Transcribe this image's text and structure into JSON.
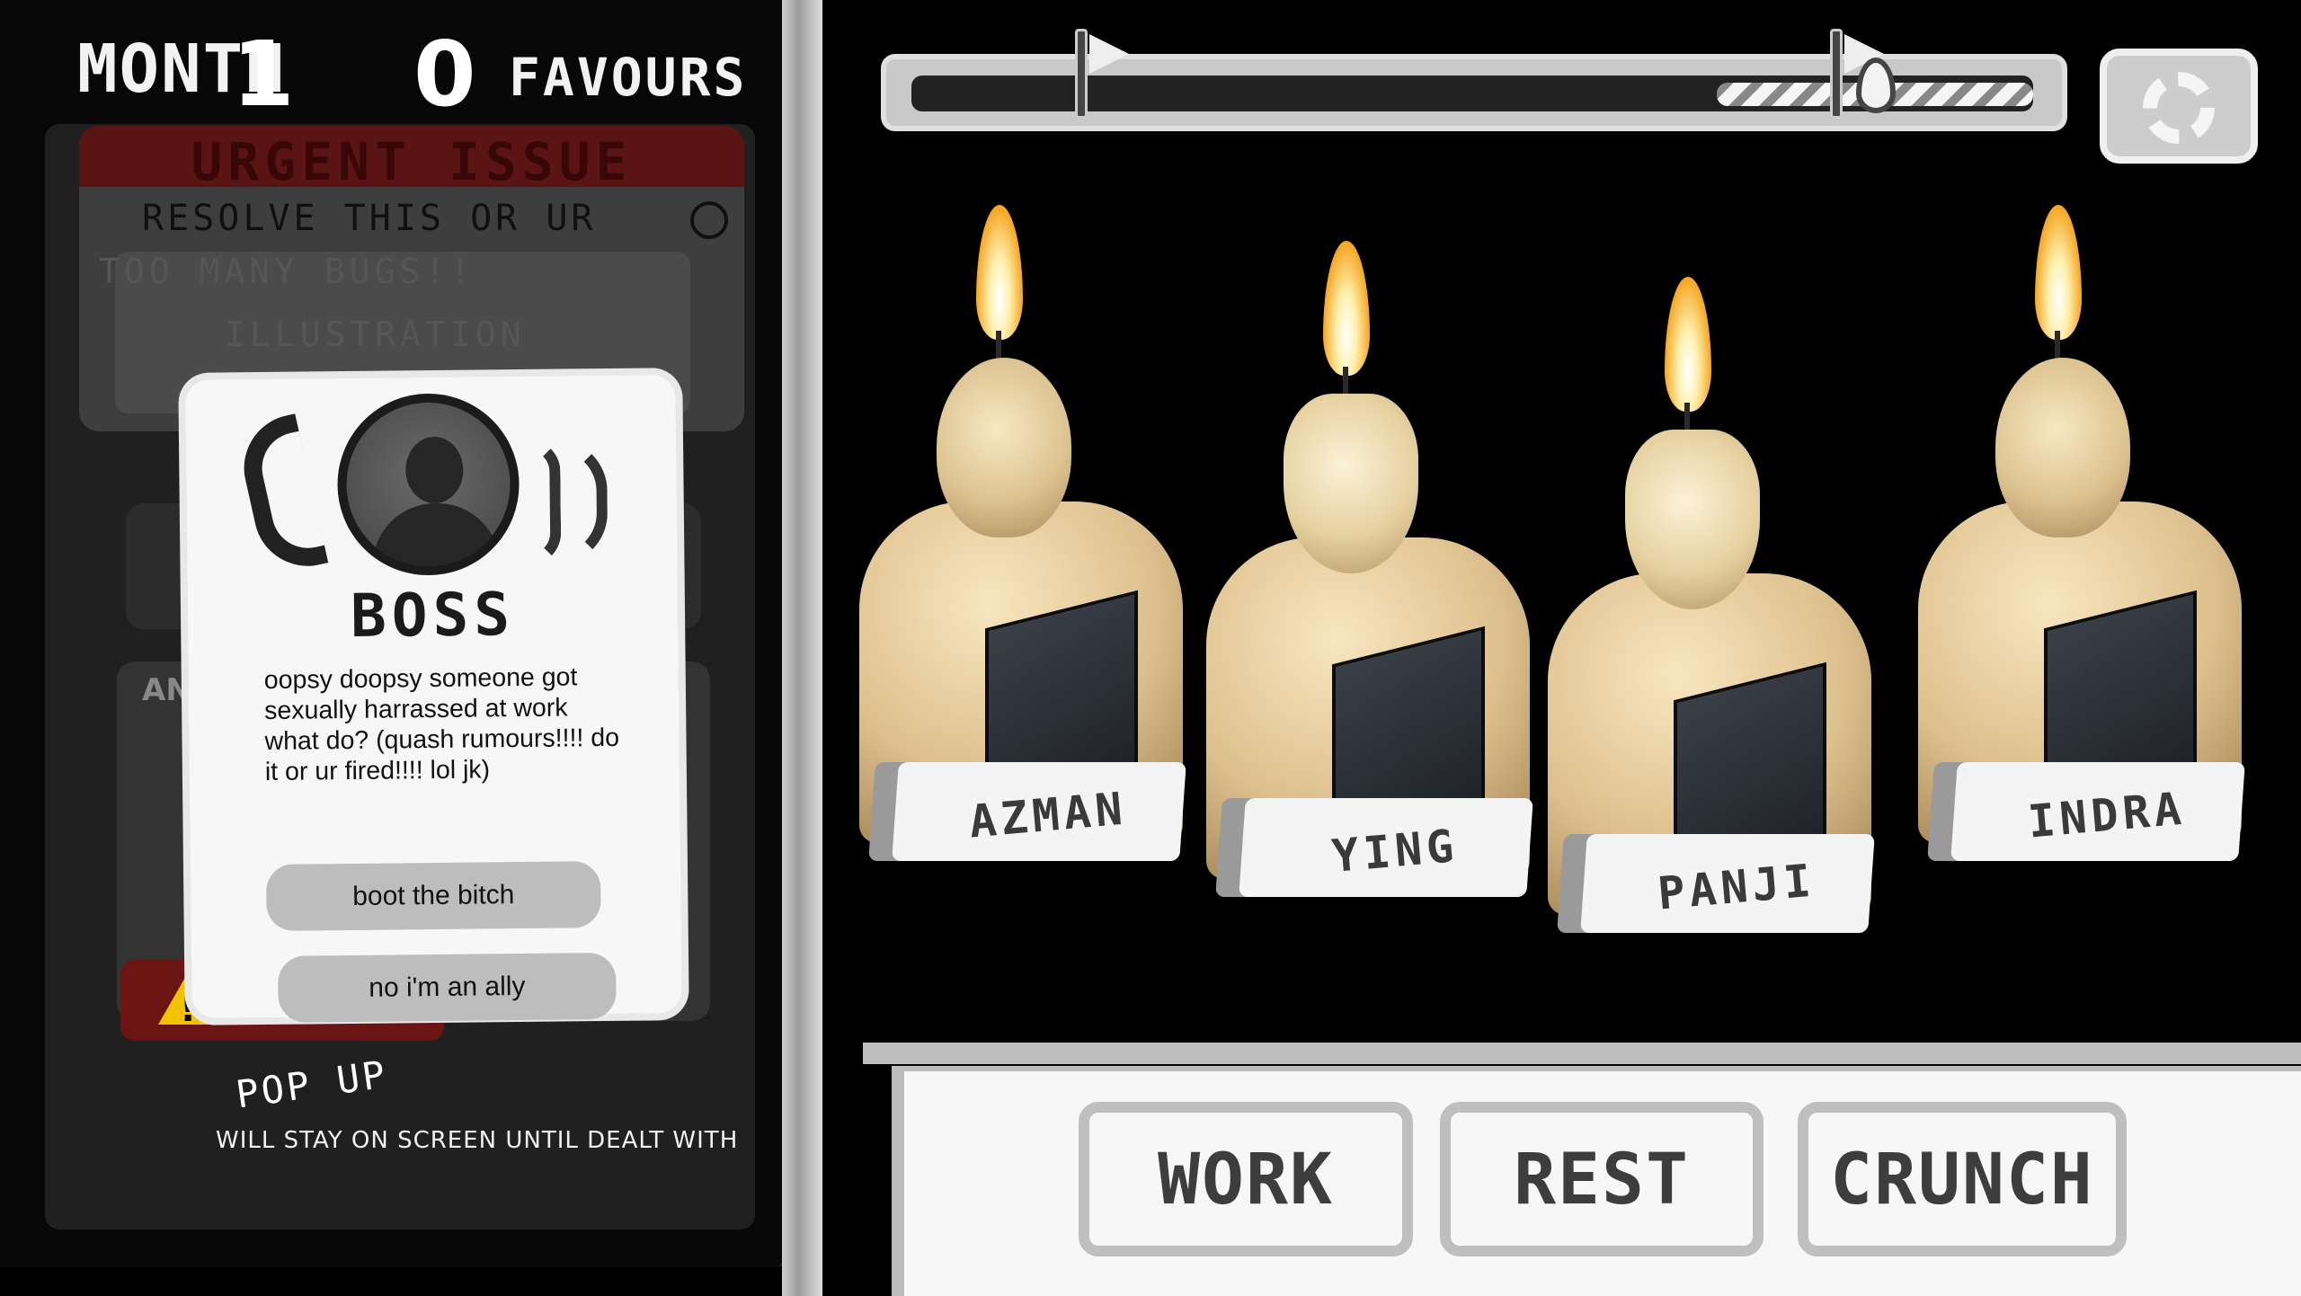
{
  "hud": {
    "month_label": "MONTH",
    "month_value": "1",
    "favours_value": "0",
    "favours_label": "FAVOURS"
  },
  "urgent_issue": {
    "title": "URGENT ISSUE",
    "subtitle": "RESOLVE THIS OR UR",
    "items": [
      "TOO MANY BUGS!!",
      "ILLUSTRATION"
    ]
  },
  "panel": {
    "block_label": "AN"
  },
  "popup": {
    "caller": "BOSS",
    "message": "oopsy doopsy someone got sexually harrassed at work what do? (quash rumours!!!! do it or ur fired!!!! lol jk)",
    "choices": [
      "boot the bitch",
      "no i'm an ally"
    ]
  },
  "annotation": {
    "title": "POP UP",
    "text": "WILL STAY ON SCREEN UNTIL DEALT WITH"
  },
  "progress": {
    "fraction": 0.86
  },
  "workers": [
    {
      "name": "AZMAN"
    },
    {
      "name": "YING"
    },
    {
      "name": "PANJI"
    },
    {
      "name": "INDRA"
    }
  ],
  "actions": {
    "work": "WORK",
    "rest": "REST",
    "crunch": "CRUNCH"
  },
  "colors": {
    "urgent_red": "#5a1414",
    "warning_yellow": "#f2c200",
    "flame_orange": "#f5a623"
  },
  "icons": [
    "phone-icon",
    "gear-icon",
    "warning-icon",
    "flag-icon",
    "flame-icon"
  ]
}
